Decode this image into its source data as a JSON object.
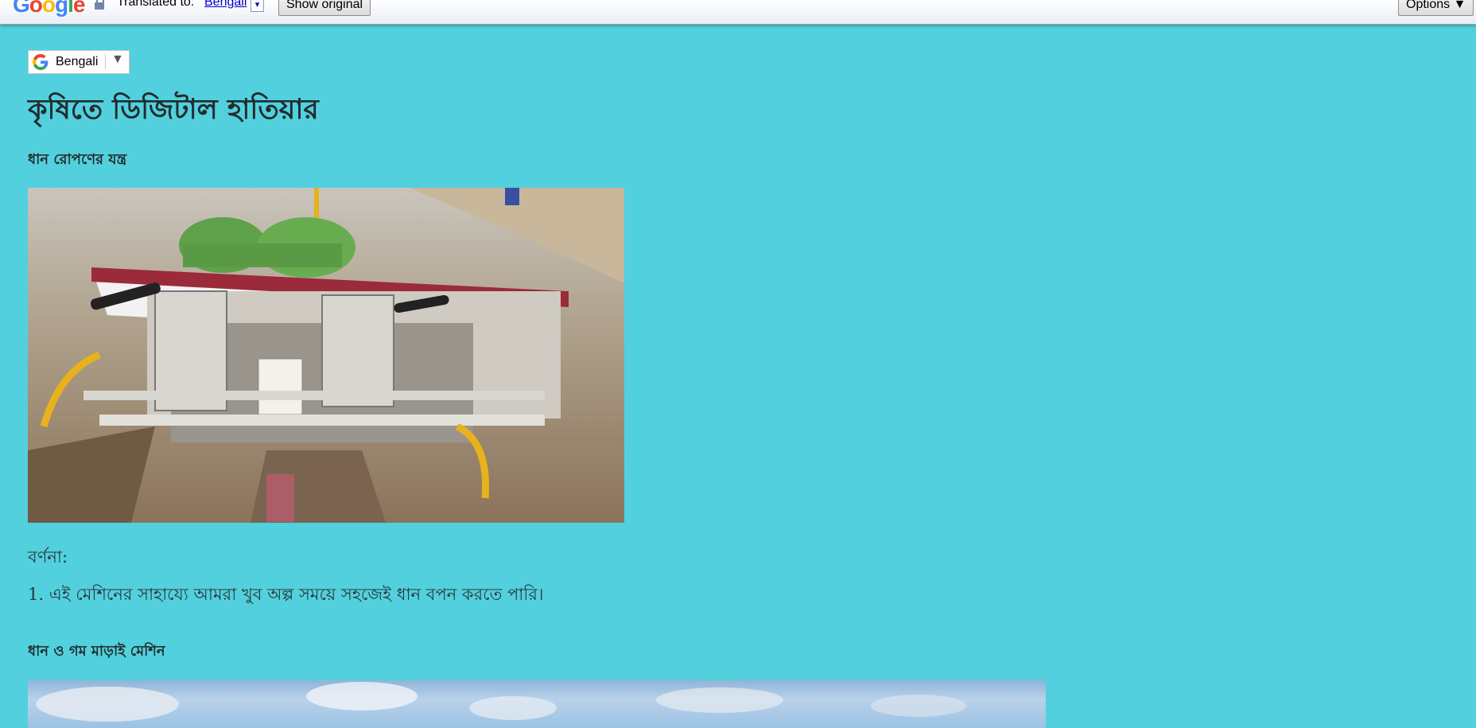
{
  "translate_bar": {
    "logo": "Google",
    "label": "Translated to:",
    "language": "Bengali",
    "dropdown_icon": "▾",
    "show_original": "Show original",
    "options": "Options ▼"
  },
  "language_selector": {
    "icon": "google-g-icon",
    "language": "Bengali",
    "arrow": "▼"
  },
  "page": {
    "title": "কৃষিতে ডিজিটাল হাতিয়ার",
    "section1_heading": "ধান রোপণের যন্ত্র",
    "description_label": "বর্ণনা:",
    "item1": "1. এই মেশিনের সাহায্যে আমরা খুব অল্প সময়ে সহজেই ধান বপন করতে পারি।",
    "section2_heading": "ধান ও গম মাড়াই মেশিন"
  },
  "colors": {
    "background": "#52d0dd",
    "text": "#212c2e",
    "link": "#0000cc"
  }
}
